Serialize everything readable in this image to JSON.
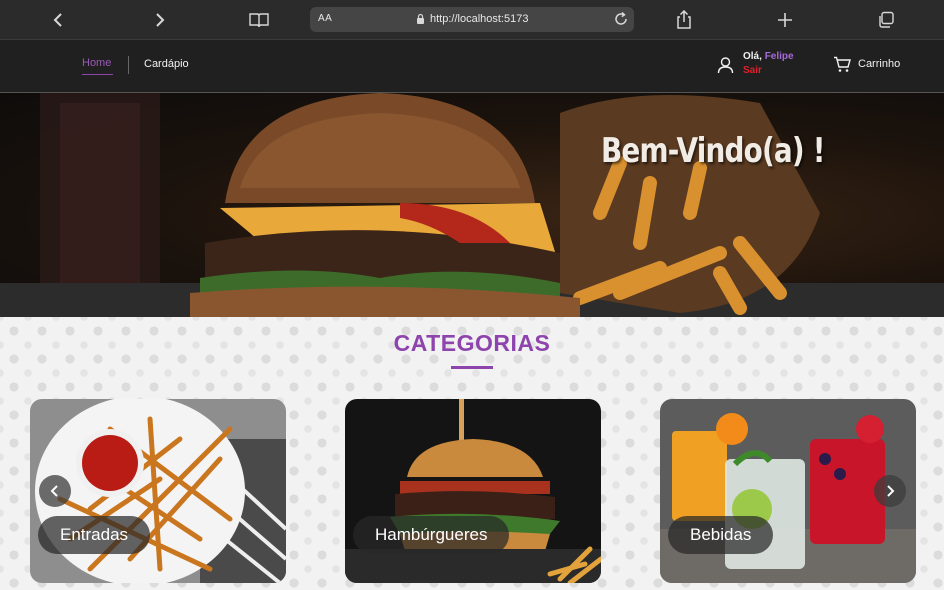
{
  "browser": {
    "url_prefix": "AA",
    "url": "http://localhost:5173"
  },
  "nav": {
    "home_label": "Home",
    "menu_label": "Cardápio",
    "greeting": "Olá,",
    "user_name": "Felipe",
    "logout_label": "Sair",
    "cart_label": "Carrinho"
  },
  "hero": {
    "title": "Bem-Vindo(a) !"
  },
  "categories": {
    "title": "CATEGORIAS",
    "items": [
      {
        "label": "Entradas"
      },
      {
        "label": "Hambúrgueres"
      },
      {
        "label": "Bebidas"
      }
    ]
  },
  "colors": {
    "accent": "#8e44ad",
    "logout": "#e0202a"
  }
}
